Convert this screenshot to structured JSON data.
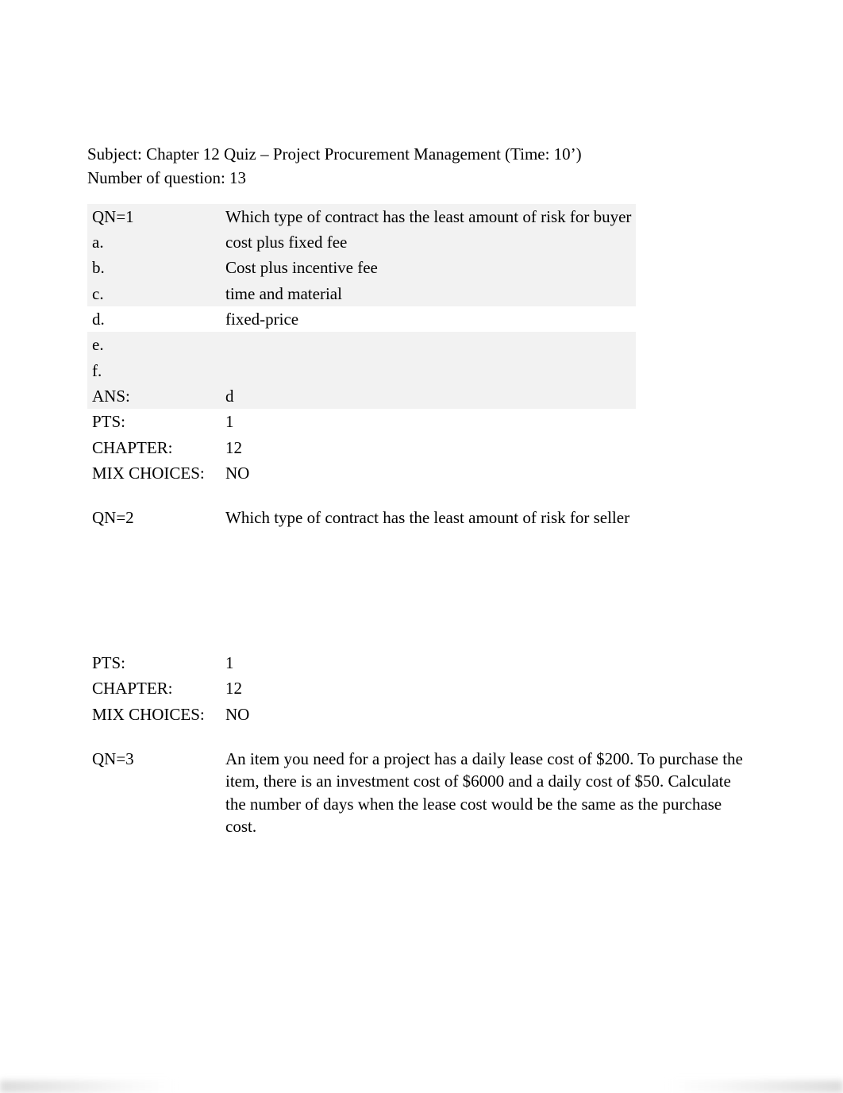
{
  "header": {
    "subject_line": "Subject: Chapter 12 Quiz – Project Procurement Management (Time: 10’)",
    "num_q_line": "Number of question: 13"
  },
  "q1": {
    "qn_label": "QN=1",
    "prompt": "Which type of contract has the least amount of risk for buyer",
    "a_label": "a.",
    "a_text": "cost plus fixed fee",
    "b_label": "b.",
    "b_text": "Cost plus incentive fee",
    "c_label": "c.",
    "c_text": "time and material",
    "d_label": "d.",
    "d_text": "fixed-price",
    "e_label": "e.",
    "e_text": "",
    "f_label": "f.",
    "f_text": "",
    "ans_label": "ANS:",
    "ans_text": "d",
    "pts_label": "PTS:",
    "pts_text": "1",
    "ch_label": "CHAPTER:",
    "ch_text": "12",
    "mix_label": "MIX CHOICES:",
    "mix_text": "NO"
  },
  "q2": {
    "qn_label": "QN=2",
    "prompt": "Which type of contract has the least amount of risk for seller",
    "pts_label": "PTS:",
    "pts_text": "1",
    "ch_label": "CHAPTER:",
    "ch_text": "12",
    "mix_label": "MIX CHOICES:",
    "mix_text": "NO"
  },
  "q3": {
    "qn_label": "QN=3",
    "prompt": "An item you need for a project has a daily lease cost of $200. To purchase the item, there is an investment cost of $6000 and a daily cost of $50. Calculate the number of days when the lease cost would be the same as the purchase cost."
  }
}
